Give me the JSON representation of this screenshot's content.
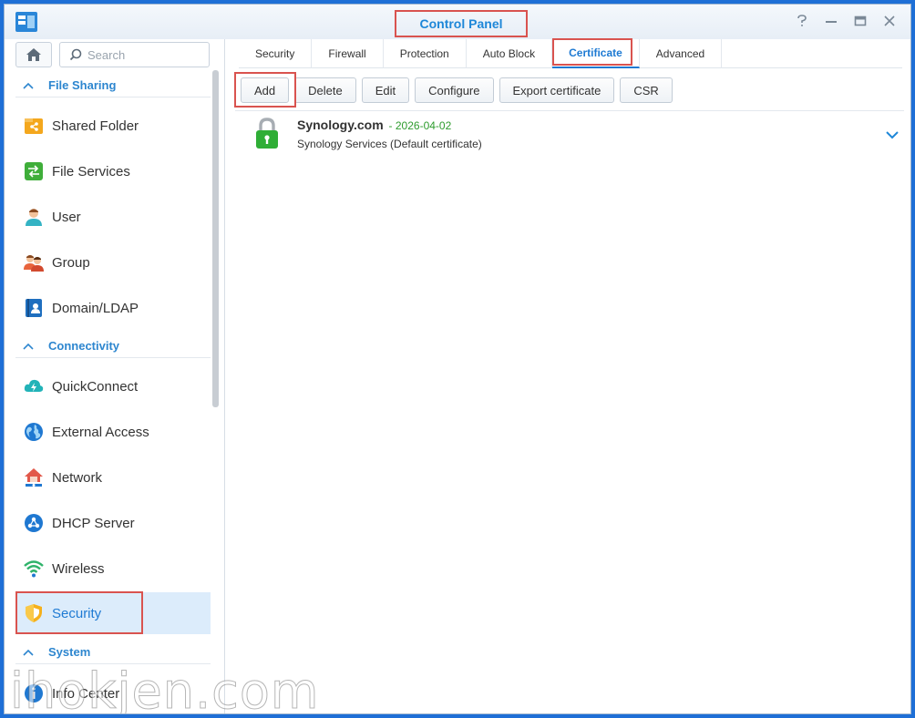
{
  "window": {
    "title": "Control Panel"
  },
  "sidebar": {
    "search_placeholder": "Search",
    "groups": [
      {
        "label": "File Sharing"
      },
      {
        "label": "Connectivity"
      },
      {
        "label": "System"
      }
    ],
    "items": [
      {
        "label": "Shared Folder",
        "icon": "shared-folder-icon"
      },
      {
        "label": "File Services",
        "icon": "file-services-icon"
      },
      {
        "label": "User",
        "icon": "user-icon"
      },
      {
        "label": "Group",
        "icon": "group-icon"
      },
      {
        "label": "Domain/LDAP",
        "icon": "domain-ldap-icon"
      },
      {
        "label": "QuickConnect",
        "icon": "quickconnect-icon"
      },
      {
        "label": "External Access",
        "icon": "external-access-icon"
      },
      {
        "label": "Network",
        "icon": "network-icon"
      },
      {
        "label": "DHCP Server",
        "icon": "dhcp-server-icon"
      },
      {
        "label": "Wireless",
        "icon": "wireless-icon"
      },
      {
        "label": "Security",
        "icon": "security-shield-icon",
        "active": true
      },
      {
        "label": "Info Center",
        "icon": "info-center-icon"
      }
    ]
  },
  "tabs": [
    {
      "label": "Security"
    },
    {
      "label": "Firewall"
    },
    {
      "label": "Protection"
    },
    {
      "label": "Auto Block"
    },
    {
      "label": "Certificate",
      "active": true
    },
    {
      "label": "Advanced"
    }
  ],
  "toolbar": {
    "add": "Add",
    "delete": "Delete",
    "edit": "Edit",
    "configure": "Configure",
    "export": "Export certificate",
    "csr": "CSR"
  },
  "certificate": {
    "name": "Synology.com",
    "date": "- 2026-04-02",
    "description": "Synology Services (Default certificate)"
  },
  "watermark": "ihokjen.com",
  "colors": {
    "accent": "#1e7ad3",
    "highlight": "#d9534f",
    "date_green": "#2e9c2e",
    "desktop": "#1e6fd6"
  }
}
